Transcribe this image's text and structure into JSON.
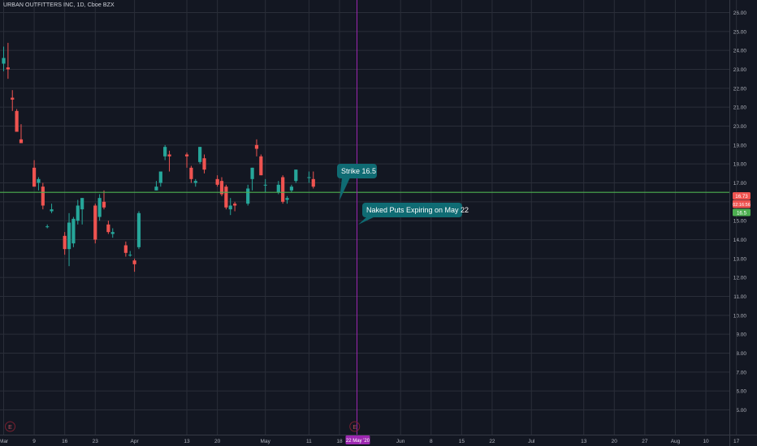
{
  "title": "URBAN OUTFITTERS INC, 1D, Cboe BZX",
  "colors": {
    "background": "#131722",
    "grid": "#2a2e39",
    "up": "#26a69a",
    "down": "#ef5350",
    "strike_line": "#4caf50",
    "expiry_line": "#9c27b0",
    "callout": "#0f6b73",
    "axis_text": "#b2b5be"
  },
  "chart_data": {
    "type": "candlestick",
    "title": "URBAN OUTFITTERS INC, 1D, Cboe BZX",
    "ylim": [
      4.7,
      26.3
    ],
    "y_ticks": [
      "26.00",
      "25.00",
      "24.00",
      "23.00",
      "22.00",
      "21.00",
      "20.00",
      "19.00",
      "18.00",
      "17.00",
      "16.00",
      "15.00",
      "14.00",
      "13.00",
      "12.00",
      "11.00",
      "10.00",
      "9.00",
      "8.00",
      "7.00",
      "6.00",
      "5.00"
    ],
    "x_ticks": [
      {
        "label": "Mar",
        "date": "2020-03-02"
      },
      {
        "label": "9",
        "date": "2020-03-09"
      },
      {
        "label": "16",
        "date": "2020-03-16"
      },
      {
        "label": "23",
        "date": "2020-03-23"
      },
      {
        "label": "Apr",
        "date": "2020-04-01"
      },
      {
        "label": "13",
        "date": "2020-04-13"
      },
      {
        "label": "20",
        "date": "2020-04-20"
      },
      {
        "label": "May",
        "date": "2020-05-01"
      },
      {
        "label": "11",
        "date": "2020-05-11"
      },
      {
        "label": "18",
        "date": "2020-05-18"
      },
      {
        "label": "Jun",
        "date": "2020-06-01"
      },
      {
        "label": "8",
        "date": "2020-06-08"
      },
      {
        "label": "15",
        "date": "2020-06-15"
      },
      {
        "label": "22",
        "date": "2020-06-22"
      },
      {
        "label": "Jul",
        "date": "2020-07-01"
      },
      {
        "label": "13",
        "date": "2020-07-13"
      },
      {
        "label": "20",
        "date": "2020-07-20"
      },
      {
        "label": "27",
        "date": "2020-07-27"
      },
      {
        "label": "Aug",
        "date": "2020-08-03"
      },
      {
        "label": "10",
        "date": "2020-08-10"
      },
      {
        "label": "17",
        "date": "2020-08-17"
      }
    ],
    "candles": [
      {
        "date": "2020-03-02",
        "open": 23.3,
        "high": 24.2,
        "low": 22.9,
        "close": 23.6
      },
      {
        "date": "2020-03-03",
        "open": 23.1,
        "high": 24.4,
        "low": 22.5,
        "close": 23.0
      },
      {
        "date": "2020-03-04",
        "open": 21.5,
        "high": 21.9,
        "low": 20.8,
        "close": 21.4
      },
      {
        "date": "2020-03-05",
        "open": 20.8,
        "high": 20.9,
        "low": 19.7,
        "close": 19.7
      },
      {
        "date": "2020-03-06",
        "open": 19.3,
        "high": 20.1,
        "low": 19.1,
        "close": 19.1
      },
      {
        "date": "2020-03-09",
        "open": 17.8,
        "high": 18.2,
        "low": 16.8,
        "close": 16.8
      },
      {
        "date": "2020-03-10",
        "open": 17.0,
        "high": 17.3,
        "low": 16.6,
        "close": 17.2
      },
      {
        "date": "2020-03-11",
        "open": 16.8,
        "high": 17.0,
        "low": 15.6,
        "close": 15.8
      },
      {
        "date": "2020-03-12",
        "open": 14.7,
        "high": 14.8,
        "low": 14.6,
        "close": 14.7
      },
      {
        "date": "2020-03-13",
        "open": 15.5,
        "high": 15.9,
        "low": 15.4,
        "close": 15.6
      },
      {
        "date": "2020-03-16",
        "open": 14.2,
        "high": 14.4,
        "low": 13.2,
        "close": 13.5
      },
      {
        "date": "2020-03-17",
        "open": 13.5,
        "high": 15.4,
        "low": 12.6,
        "close": 14.9
      },
      {
        "date": "2020-03-18",
        "open": 13.8,
        "high": 15.2,
        "low": 13.6,
        "close": 15.1
      },
      {
        "date": "2020-03-19",
        "open": 15.0,
        "high": 16.1,
        "low": 14.8,
        "close": 15.8
      },
      {
        "date": "2020-03-20",
        "open": 15.6,
        "high": 16.2,
        "low": 14.8,
        "close": 16.2
      },
      {
        "date": "2020-03-23",
        "open": 15.8,
        "high": 15.9,
        "low": 13.8,
        "close": 14.0
      },
      {
        "date": "2020-03-24",
        "open": 15.2,
        "high": 16.4,
        "low": 15.0,
        "close": 16.2
      },
      {
        "date": "2020-03-25",
        "open": 16.0,
        "high": 16.6,
        "low": 15.6,
        "close": 15.7
      },
      {
        "date": "2020-03-26",
        "open": 14.8,
        "high": 15.0,
        "low": 14.3,
        "close": 14.4
      },
      {
        "date": "2020-03-27",
        "open": 14.3,
        "high": 14.6,
        "low": 14.1,
        "close": 14.4
      },
      {
        "date": "2020-03-30",
        "open": 13.7,
        "high": 13.9,
        "low": 13.1,
        "close": 13.3
      },
      {
        "date": "2020-03-31",
        "open": 13.2,
        "high": 13.4,
        "low": 13.1,
        "close": 13.2
      },
      {
        "date": "2020-04-01",
        "open": 12.9,
        "high": 13.0,
        "low": 12.3,
        "close": 12.7
      },
      {
        "date": "2020-04-02",
        "open": 13.6,
        "high": 15.5,
        "low": 13.5,
        "close": 15.4
      },
      {
        "date": "2020-04-06",
        "open": 16.6,
        "high": 17.1,
        "low": 16.6,
        "close": 16.8
      },
      {
        "date": "2020-04-07",
        "open": 17.0,
        "high": 17.6,
        "low": 16.8,
        "close": 17.6
      },
      {
        "date": "2020-04-08",
        "open": 18.4,
        "high": 19.0,
        "low": 18.2,
        "close": 18.9
      },
      {
        "date": "2020-04-09",
        "open": 18.5,
        "high": 18.7,
        "low": 17.6,
        "close": 18.4
      },
      {
        "date": "2020-04-13",
        "open": 18.5,
        "high": 18.6,
        "low": 17.8,
        "close": 18.4
      },
      {
        "date": "2020-04-14",
        "open": 17.8,
        "high": 17.9,
        "low": 17.0,
        "close": 17.2
      },
      {
        "date": "2020-04-15",
        "open": 17.0,
        "high": 17.2,
        "low": 16.8,
        "close": 17.1
      },
      {
        "date": "2020-04-16",
        "open": 18.1,
        "high": 18.9,
        "low": 18.0,
        "close": 18.9
      },
      {
        "date": "2020-04-17",
        "open": 18.3,
        "high": 18.5,
        "low": 17.5,
        "close": 17.7
      },
      {
        "date": "2020-04-20",
        "open": 17.2,
        "high": 17.4,
        "low": 16.8,
        "close": 16.9
      },
      {
        "date": "2020-04-21",
        "open": 17.1,
        "high": 17.3,
        "low": 16.3,
        "close": 16.4
      },
      {
        "date": "2020-04-22",
        "open": 16.8,
        "high": 16.9,
        "low": 15.6,
        "close": 15.7
      },
      {
        "date": "2020-04-23",
        "open": 15.6,
        "high": 16.2,
        "low": 15.3,
        "close": 15.8
      },
      {
        "date": "2020-04-24",
        "open": 15.9,
        "high": 16.0,
        "low": 15.5,
        "close": 15.8
      },
      {
        "date": "2020-04-27",
        "open": 15.9,
        "high": 16.9,
        "low": 15.8,
        "close": 16.7
      },
      {
        "date": "2020-04-28",
        "open": 17.2,
        "high": 17.8,
        "low": 16.6,
        "close": 17.8
      },
      {
        "date": "2020-04-29",
        "open": 19.0,
        "high": 19.3,
        "low": 18.4,
        "close": 18.8
      },
      {
        "date": "2020-04-30",
        "open": 18.4,
        "high": 18.5,
        "low": 17.4,
        "close": 17.4
      },
      {
        "date": "2020-05-01",
        "open": 16.9,
        "high": 17.2,
        "low": 16.5,
        "close": 16.9
      },
      {
        "date": "2020-05-04",
        "open": 16.5,
        "high": 17.1,
        "low": 16.4,
        "close": 16.9
      },
      {
        "date": "2020-05-05",
        "open": 17.3,
        "high": 17.4,
        "low": 15.9,
        "close": 16.0
      },
      {
        "date": "2020-05-06",
        "open": 16.1,
        "high": 16.3,
        "low": 15.9,
        "close": 16.2
      },
      {
        "date": "2020-05-07",
        "open": 16.6,
        "high": 16.9,
        "low": 16.5,
        "close": 16.8
      },
      {
        "date": "2020-05-08",
        "open": 17.1,
        "high": 17.7,
        "low": 17.0,
        "close": 17.7
      },
      {
        "date": "2020-05-11",
        "open": 17.3,
        "high": 17.6,
        "low": 17.0,
        "close": 17.3
      },
      {
        "date": "2020-05-12",
        "open": 17.2,
        "high": 17.6,
        "low": 16.7,
        "close": 16.8
      }
    ],
    "horizontal_line": {
      "value": 16.5
    },
    "vertical_line": {
      "date": "2020-05-22"
    },
    "price_labels": [
      "16.73",
      "02:16:56",
      "16.5"
    ],
    "annotations": [
      "Strike 16.5",
      "Naked Puts Expiring on May 22"
    ],
    "event_markers": [
      {
        "date": "2020-03-02",
        "label": "E"
      },
      {
        "date": "2020-05-20",
        "label": "E"
      }
    ],
    "highlighted_date_label": "22 May '20",
    "grid": true
  }
}
